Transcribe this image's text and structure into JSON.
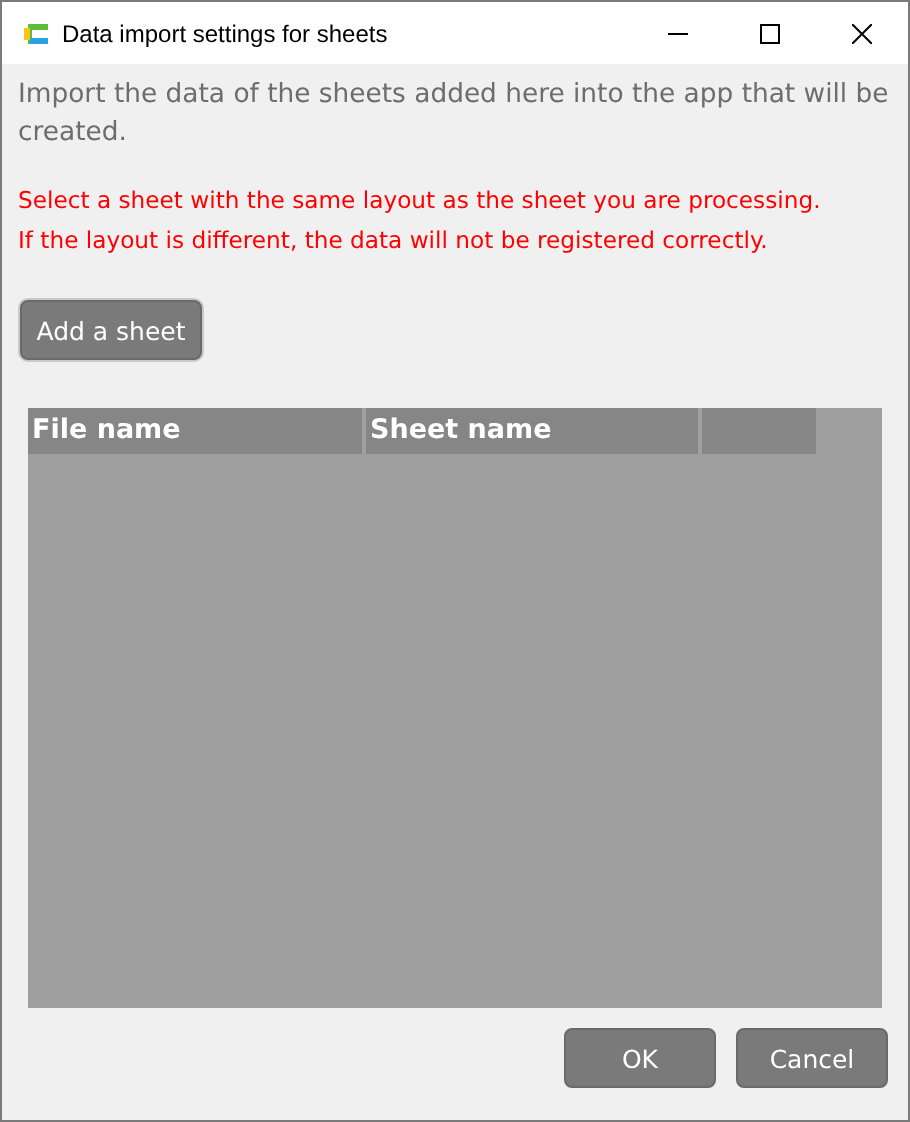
{
  "window": {
    "title": "Data import settings for sheets"
  },
  "description": "Import the data of the sheets added here into the app that will be created.",
  "warnings": [
    "Select a sheet with the same layout as the sheet you are processing.",
    "If the layout is different, the data will not be registered correctly."
  ],
  "add_button": "Add a sheet",
  "table": {
    "columns": [
      {
        "kind": "heading",
        "label": "File name"
      },
      {
        "kind": "heading",
        "label": "Sheet name"
      },
      {
        "kind": "empty"
      }
    ]
  },
  "buttons": [
    "OK",
    "Cancel"
  ]
}
